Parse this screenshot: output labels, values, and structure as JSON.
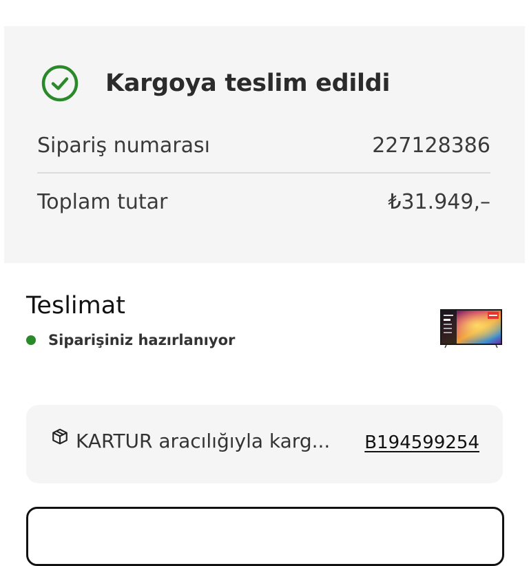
{
  "order": {
    "status_title": "Kargoya teslim edildi",
    "order_number_label": "Sipariş numarası",
    "order_number_value": "227128386",
    "total_label": "Toplam tutar",
    "total_value": "₺31.949,–"
  },
  "delivery": {
    "title": "Teslimat",
    "status": "Siparişiniz hazırlanıyor",
    "status_color": "#2a8a2a"
  },
  "tracking": {
    "carrier_text": "KARTUR aracılığıyla karg...",
    "tracking_number": "B194599254",
    "icon": "package-icon"
  },
  "colors": {
    "accent_green": "#2a8a2a",
    "card_background": "#f5f5f5"
  }
}
